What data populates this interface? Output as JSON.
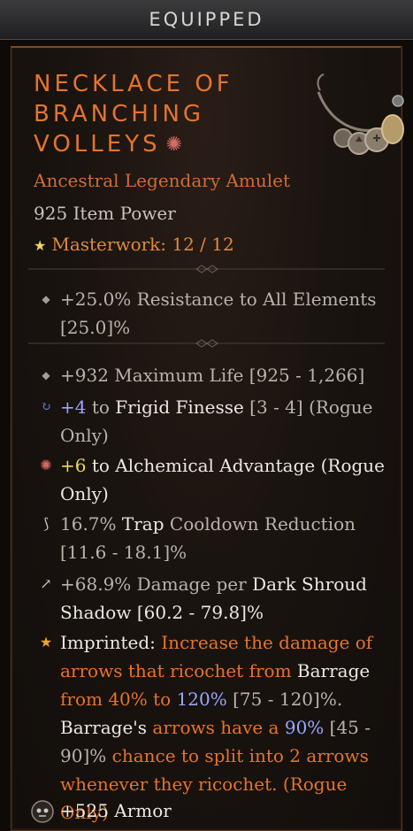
{
  "header": {
    "title": "EQUIPPED"
  },
  "item": {
    "name_lines": [
      "NECKLACE OF",
      "BRANCHING",
      "VOLLEYS"
    ],
    "type": "Ancestral Legendary Amulet",
    "item_power": "925 Item Power",
    "masterwork": "Masterwork: 12 / 12"
  },
  "affixes": {
    "resistance": {
      "text": "+25.0% Resistance to All Elements",
      "range": "[25.0]%"
    },
    "life": {
      "text": "+932 Maximum Life [925 - 1,266]"
    },
    "frigid": {
      "value": "+4",
      "pre": " to ",
      "skill": "Frigid Finesse",
      "range": " [3 - 4] (Rogue",
      "cont": "Only)"
    },
    "alchemical": {
      "value": "+6",
      "pre": " to ",
      "skill": "Alchemical Advantage (Rogue",
      "cont": "Only)"
    },
    "trap": {
      "value": "16.7% ",
      "skill": "Trap",
      "post": " Cooldown Reduction",
      "range": "[11.6 - 18.1]%"
    },
    "shroud": {
      "pre": "+68.9% Damage per ",
      "skill": "Dark Shroud",
      "cont": "Shadow [60.2 - 79.8]%"
    },
    "imprint": {
      "label": "Imprinted: ",
      "l1": "Increase the damage of",
      "l2a": "arrows that ricochet from ",
      "l2b": "Barrage",
      "l3a": "from 40% to ",
      "l3b": "120%",
      "l3c": " [75 - 120]%.",
      "l4a": "Barrage's",
      "l4b": " arrows have a ",
      "l4c": "90%",
      "l4d": " [45 -",
      "l5a": "90]%",
      "l5b": " chance to split into 2 arrows",
      "l6": "whenever they ricochet. (Rogue Only)"
    },
    "armor": {
      "text": "+525 Armor"
    }
  },
  "colors": {
    "legendary": "#e4742c",
    "header_bg": "#2b2b2d",
    "body_bg": "#120e0b"
  }
}
